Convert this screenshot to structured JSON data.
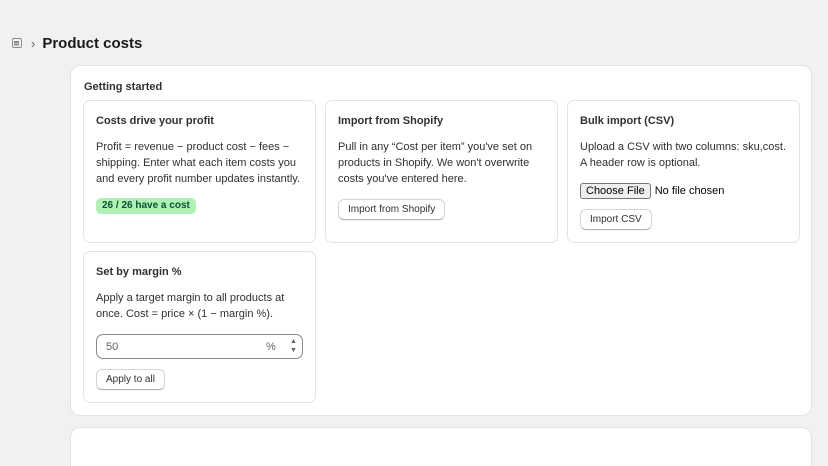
{
  "header": {
    "title": "Product costs",
    "icon": "page-icon",
    "separator": "›"
  },
  "getting_started": {
    "title": "Getting started",
    "cards": {
      "profit": {
        "title": "Costs drive your profit",
        "lines": [
          "Profit = revenue − product cost − fees −",
          "shipping. Enter what each item costs you",
          "and every profit number updates instantly."
        ],
        "badge": "26 / 26 have a cost"
      },
      "shopify": {
        "title": "Import from Shopify",
        "lines": [
          "Pull in any “Cost per item” you've set on",
          "products in Shopify. We won't overwrite",
          "costs you've entered here."
        ],
        "button": "Import from Shopify"
      },
      "bulk": {
        "title": "Bulk import (CSV)",
        "lines": [
          "Upload a CSV with two columns: sku,cost.",
          "A header row is optional."
        ],
        "file_button": "Choose File",
        "file_status": "No file chosen",
        "button": "Import CSV"
      },
      "margin": {
        "title": "Set by margin %",
        "lines": [
          "Apply a target margin to all products at",
          "once. Cost = price × (1 − margin %)."
        ],
        "input_value": "50",
        "input_suffix": "%",
        "button": "Apply to all"
      }
    }
  },
  "next_panel": {
    "title": ""
  },
  "colors": {
    "background": "#f1f1f1",
    "badge_bg": "#aff0b5",
    "badge_text": "#0c5132"
  }
}
